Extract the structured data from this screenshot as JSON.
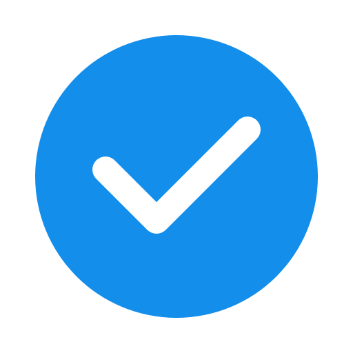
{
  "icon": {
    "name": "check-circle-icon",
    "circle_color": "#138EEB",
    "check_color": "#FFFFFF",
    "background_color": "#FFFFFF"
  }
}
